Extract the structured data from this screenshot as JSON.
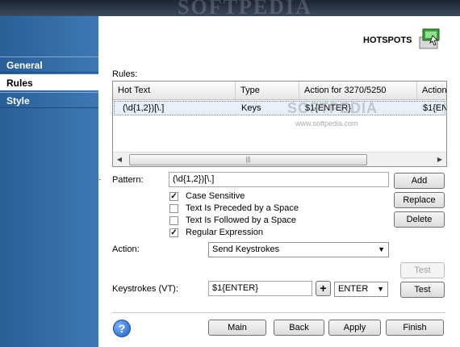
{
  "watermark": "SOFTPEDIA",
  "sidebar": {
    "items": [
      {
        "label": "General",
        "active": false
      },
      {
        "label": "Rules",
        "active": true
      },
      {
        "label": "Style",
        "active": false
      }
    ]
  },
  "header": {
    "title": "HOTSPOTS",
    "icon": "hotspots-icon"
  },
  "rules": {
    "label": "Rules:",
    "columns": [
      "Hot Text",
      "Type",
      "Action for 3270/5250",
      "Action"
    ],
    "rows": [
      {
        "hot_text": "(\\d{1,2})[\\.]",
        "type": "Keys",
        "action_3270": "$1{ENTER}",
        "action": "$1{EN"
      }
    ],
    "row_watermark": "SOFTPEDIA",
    "row_url": "www.softpedia.com"
  },
  "pattern": {
    "label": "Pattern:",
    "value": "(\\d{1,2})[\\.]"
  },
  "options": [
    {
      "label": "Case Sensitive",
      "checked": true
    },
    {
      "label": "Text Is Preceded by a Space",
      "checked": false
    },
    {
      "label": "Text Is Followed by a Space",
      "checked": false
    },
    {
      "label": "Regular Expression",
      "checked": true
    }
  ],
  "action": {
    "label": "Action:",
    "value": "Send Keystrokes"
  },
  "keystrokes": {
    "label": "Keystrokes (VT):",
    "value": "$1{ENTER}",
    "plus": "+",
    "key_value": "ENTER"
  },
  "buttons": {
    "add": "Add",
    "replace": "Replace",
    "delete": "Delete",
    "test_disabled": "Test",
    "test": "Test",
    "main": "Main",
    "back": "Back",
    "apply": "Apply",
    "finish": "Finish",
    "help": "?"
  },
  "scroll_thumb_grip": "|||",
  "colors": {
    "sidebar": "#3e78b4",
    "selected_row": "#e8f0fb",
    "help": "#1c5bc0"
  }
}
